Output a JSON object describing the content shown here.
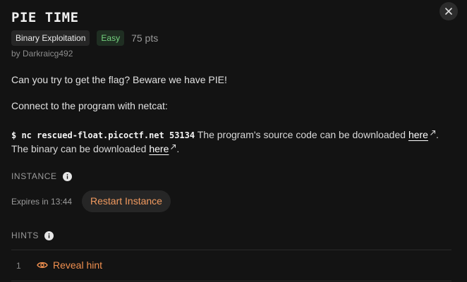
{
  "challenge": {
    "title": "PIE TIME",
    "category": "Binary Exploitation",
    "difficulty": "Easy",
    "points": "75 pts",
    "author": "by Darkraicg492",
    "close_icon": "close-icon"
  },
  "description": {
    "intro": "Can you try to get the flag? Beware we have PIE!",
    "connect": "Connect to the program with netcat:",
    "command": "$ nc rescued-float.picoctf.net 53134",
    "source_text": "The program's source code can be downloaded",
    "source_link": "here",
    "period1": ".",
    "binary_text": "The binary can be downloaded",
    "binary_link": "here",
    "period2": "."
  },
  "instance": {
    "label": "INSTANCE",
    "expires": "Expires in 13:44",
    "restart_label": "Restart Instance"
  },
  "hints": {
    "label": "HINTS",
    "items": [
      {
        "number": "1",
        "label": "Reveal hint",
        "icon": "eye-icon"
      }
    ]
  },
  "colors": {
    "background": "#131313",
    "accent": "#ef8f4f",
    "difficulty_green": "#74d27f",
    "tag_background": "#262626"
  }
}
